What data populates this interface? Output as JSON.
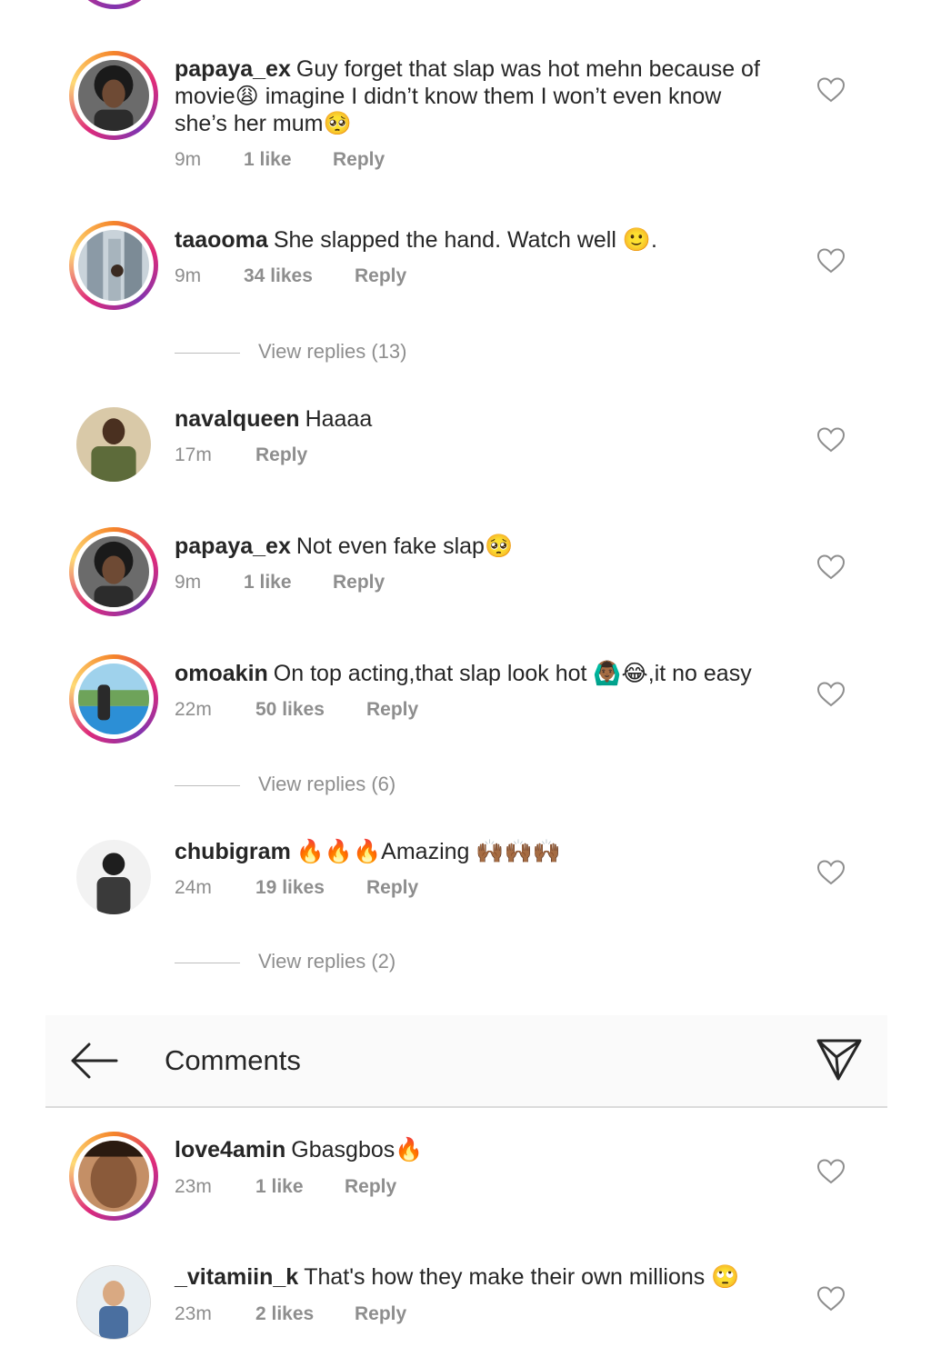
{
  "header": {
    "title": "Comments",
    "back_icon": "arrow-left-icon",
    "send_icon": "paper-plane-icon"
  },
  "comments": [
    {
      "username": "papaya_ex",
      "text": "Guy forget that slap was hot mehn because of movie😩 imagine I didn’t know them I won’t even know she’s her mum🥺",
      "time": "9m",
      "likes": "1 like",
      "reply": "Reply"
    },
    {
      "username": "taaooma",
      "text": "She slapped the hand. Watch well 🙂.",
      "time": "9m",
      "likes": "34 likes",
      "reply": "Reply",
      "view_replies": "View replies (13)"
    },
    {
      "username": "navalqueen",
      "text": "Haaaa",
      "time": "17m",
      "likes": "",
      "reply": "Reply"
    },
    {
      "username": "papaya_ex",
      "text": "Not even fake slap🥺",
      "time": "9m",
      "likes": "1 like",
      "reply": "Reply"
    },
    {
      "username": "omoakin",
      "text": "On top acting,that slap look hot 🙆🏾‍♂️😂,it no easy",
      "time": "22m",
      "likes": "50 likes",
      "reply": "Reply",
      "view_replies": "View replies (6)"
    },
    {
      "username": "chubigram",
      "text": "🔥🔥🔥Amazing 🙌🏾🙌🏾🙌🏾",
      "time": "24m",
      "likes": "19 likes",
      "reply": "Reply",
      "view_replies": "View replies (2)"
    },
    {
      "username": "love4amin",
      "text": "Gbasgbos🔥",
      "time": "23m",
      "likes": "1 like",
      "reply": "Reply"
    },
    {
      "username": "_vitamiin_k",
      "text": "That's how they make their own millions 🙄",
      "time": "23m",
      "likes": "2 likes",
      "reply": "Reply"
    }
  ],
  "icons": {
    "like": "heart-icon"
  },
  "colors": {
    "story_ring_start": "#f58529",
    "story_ring_mid": "#dd2a7b",
    "meta_gray": "#8e8e8e",
    "text": "#262626"
  }
}
